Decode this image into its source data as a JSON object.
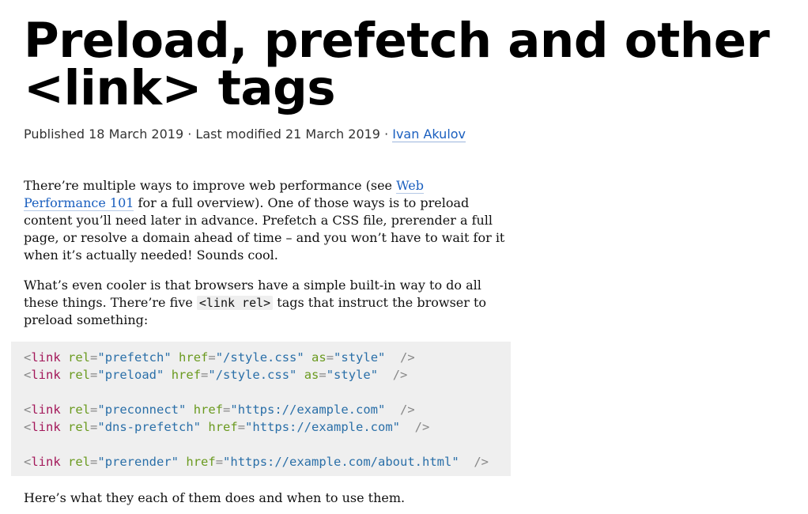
{
  "article": {
    "title_line1": "Preload, prefetch and other",
    "title_line2": "<link> tags",
    "meta_prefix": "Published 18 March 2019 · Last modified 21 March 2019 · ",
    "author": "Ivan Akulov"
  },
  "paragraph1": {
    "before_link": "There’re multiple ways to improve web performance (see ",
    "link_text": "Web Performance 101",
    "after_link": " for a full overview). One of those ways is to preload content you’ll need later in advance. Prefetch a CSS file, prerender a full page, or resolve a domain ahead of time – and you won’t have to wait for it when it’s actually needed! Sounds cool."
  },
  "paragraph2": {
    "before_code": "What’s even cooler is that browsers have a simple built-in way to do all these things. There’re five ",
    "code": "<link rel>",
    "after_code": " tags that instruct the browser to preload something:"
  },
  "code_block": [
    {
      "open": "<",
      "tag": "link",
      "a1": "rel",
      "v1": "\"prefetch\"",
      "a2": "href",
      "v2": "\"/style.css\"",
      "a3": "as",
      "v3": "\"style\"",
      "close": "/>"
    },
    {
      "open": "<",
      "tag": "link",
      "a1": "rel",
      "v1": "\"preload\"",
      "a2": "href",
      "v2": "\"/style.css\"",
      "a3": "as",
      "v3": "\"style\"",
      "close": "/>"
    },
    {
      "blank": true
    },
    {
      "open": "<",
      "tag": "link",
      "a1": "rel",
      "v1": "\"preconnect\"",
      "a2": "href",
      "v2": "\"https://example.com\"",
      "close": "/>"
    },
    {
      "open": "<",
      "tag": "link",
      "a1": "rel",
      "v1": "\"dns-prefetch\"",
      "a2": "href",
      "v2": "\"https://example.com\"",
      "close": "/>"
    },
    {
      "blank": true
    },
    {
      "open": "<",
      "tag": "link",
      "a1": "rel",
      "v1": "\"prerender\"",
      "a2": "href",
      "v2": "\"https://example.com/about.html\"",
      "close": "/>"
    }
  ],
  "paragraph3": {
    "text": "Here’s what they each of them does and when to use them."
  },
  "colors": {
    "link": "#1a5fbf",
    "code_background": "#efefef",
    "code_tag": "#a3185a",
    "code_attr": "#6a9a1f",
    "code_string": "#2a6fa8"
  }
}
